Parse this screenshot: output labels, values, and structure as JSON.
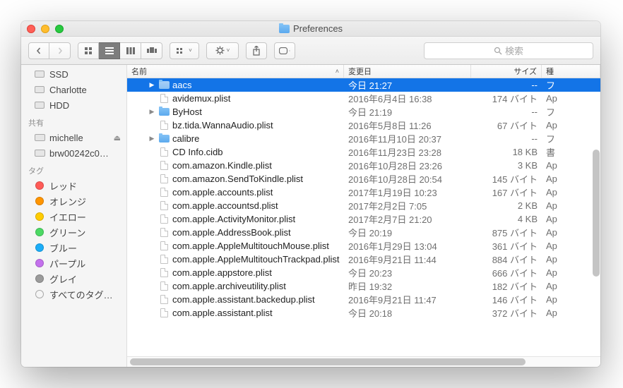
{
  "window": {
    "title": "Preferences"
  },
  "search": {
    "placeholder": "検索"
  },
  "sidebar": {
    "devices": [
      {
        "label": "SSD",
        "icon": "disk"
      },
      {
        "label": "Charlotte",
        "icon": "disk"
      },
      {
        "label": "HDD",
        "icon": "disk"
      }
    ],
    "shared_header": "共有",
    "shared": [
      {
        "label": "michelle",
        "icon": "monitor",
        "eject": true
      },
      {
        "label": "brw00242c0…",
        "icon": "monitor"
      }
    ],
    "tags_header": "タグ",
    "tags": [
      {
        "label": "レッド",
        "color": "#ff5b57"
      },
      {
        "label": "オレンジ",
        "color": "#ff9500"
      },
      {
        "label": "イエロー",
        "color": "#ffcc00"
      },
      {
        "label": "グリーン",
        "color": "#4cd964"
      },
      {
        "label": "ブルー",
        "color": "#1badf8"
      },
      {
        "label": "パープル",
        "color": "#c471ed"
      },
      {
        "label": "グレイ",
        "color": "#9b9b9b"
      }
    ],
    "all_tags": "すべてのタグ…"
  },
  "columns": {
    "name": "名前",
    "date": "変更日",
    "size": "サイズ",
    "kind": "種"
  },
  "rows": [
    {
      "name": "aacs",
      "type": "folder",
      "date": "今日 21:27",
      "size": "--",
      "kind": "フ",
      "expandable": true,
      "selected": true
    },
    {
      "name": "avidemux.plist",
      "type": "file",
      "date": "2016年6月4日 16:38",
      "size": "174 バイト",
      "kind": "Ap"
    },
    {
      "name": "ByHost",
      "type": "folder",
      "date": "今日 21:19",
      "size": "--",
      "kind": "フ",
      "expandable": true
    },
    {
      "name": "bz.tida.WannaAudio.plist",
      "type": "file",
      "date": "2016年5月8日 11:26",
      "size": "67 バイト",
      "kind": "Ap"
    },
    {
      "name": "calibre",
      "type": "folder",
      "date": "2016年11月10日 20:37",
      "size": "--",
      "kind": "フ",
      "expandable": true
    },
    {
      "name": "CD Info.cidb",
      "type": "file",
      "date": "2016年11月23日 23:28",
      "size": "18 KB",
      "kind": "書"
    },
    {
      "name": "com.amazon.Kindle.plist",
      "type": "file",
      "date": "2016年10月28日 23:26",
      "size": "3 KB",
      "kind": "Ap"
    },
    {
      "name": "com.amazon.SendToKindle.plist",
      "type": "file",
      "date": "2016年10月28日 20:54",
      "size": "145 バイト",
      "kind": "Ap"
    },
    {
      "name": "com.apple.accounts.plist",
      "type": "file",
      "date": "2017年1月19日 10:23",
      "size": "167 バイト",
      "kind": "Ap"
    },
    {
      "name": "com.apple.accountsd.plist",
      "type": "file",
      "date": "2017年2月2日 7:05",
      "size": "2 KB",
      "kind": "Ap"
    },
    {
      "name": "com.apple.ActivityMonitor.plist",
      "type": "file",
      "date": "2017年2月7日 21:20",
      "size": "4 KB",
      "kind": "Ap"
    },
    {
      "name": "com.apple.AddressBook.plist",
      "type": "file",
      "date": "今日 20:19",
      "size": "875 バイト",
      "kind": "Ap"
    },
    {
      "name": "com.apple.AppleMultitouchMouse.plist",
      "type": "file",
      "date": "2016年1月29日 13:04",
      "size": "361 バイト",
      "kind": "Ap"
    },
    {
      "name": "com.apple.AppleMultitouchTrackpad.plist",
      "type": "file",
      "date": "2016年9月21日 11:44",
      "size": "884 バイト",
      "kind": "Ap"
    },
    {
      "name": "com.apple.appstore.plist",
      "type": "file",
      "date": "今日 20:23",
      "size": "666 バイト",
      "kind": "Ap"
    },
    {
      "name": "com.apple.archiveutility.plist",
      "type": "file",
      "date": "昨日 19:32",
      "size": "182 バイト",
      "kind": "Ap"
    },
    {
      "name": "com.apple.assistant.backedup.plist",
      "type": "file",
      "date": "2016年9月21日 11:47",
      "size": "146 バイト",
      "kind": "Ap"
    },
    {
      "name": "com.apple.assistant.plist",
      "type": "file",
      "date": "今日 20:18",
      "size": "372 バイト",
      "kind": "Ap"
    }
  ]
}
